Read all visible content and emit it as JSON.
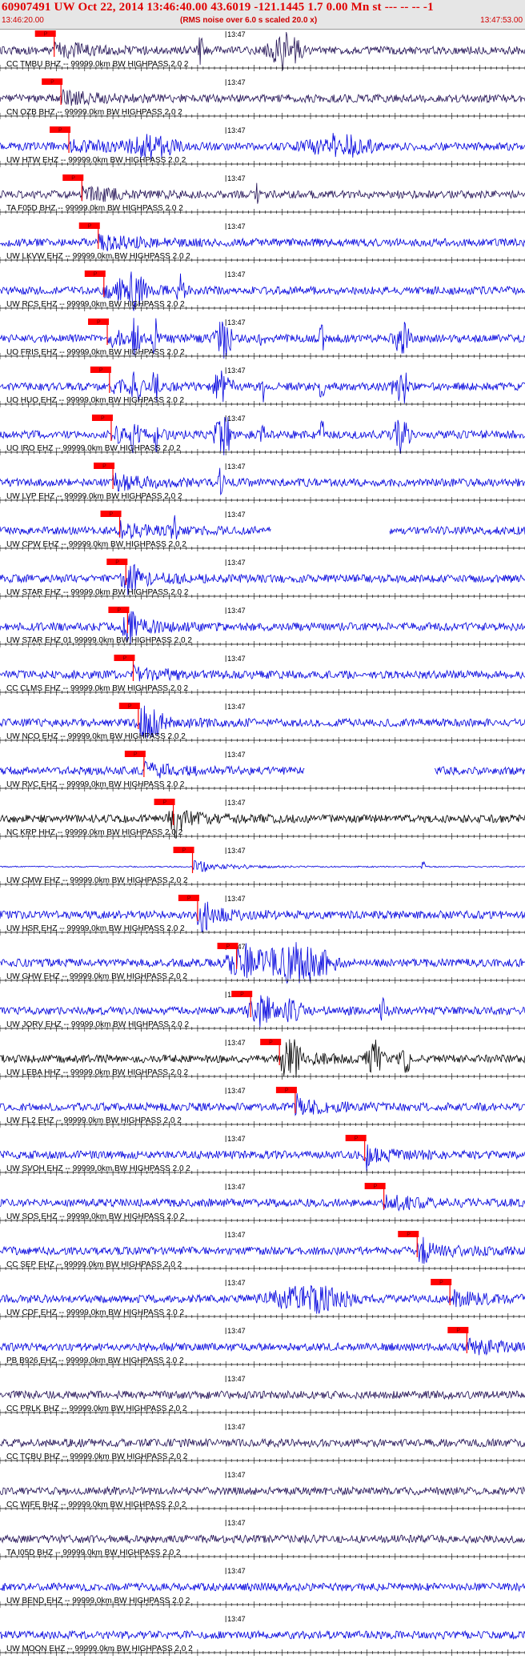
{
  "header": {
    "title": "60907491 UW Oct 22, 2014 13:46:40.00   43.6019 -121.1445  1.7 0.00 Mn st --- -- --   -1",
    "start_time": "13:46:20.00",
    "subtitle": "(RMS noise over 6.0 s scaled 20.0 x)",
    "end_time": "13:47:53.00"
  },
  "minute_mark_label": "13:47",
  "pick_label": "P",
  "colors": {
    "header_bg": "#e6e6e6",
    "header_text": "#e00000",
    "trace_blue": "#0000dd",
    "trace_dark": "#221155",
    "trace_black": "#000000",
    "pick": "#ff0000",
    "axis": "#000000"
  },
  "traces": [
    {
      "label": "CC TMBU BHZ -- 99999.0km BW  HIGHPASS  2.0  2",
      "color": "dark",
      "pick_s": 9.6,
      "events": [
        {
          "t": 13.5,
          "a": 0.9,
          "d": 0.6
        },
        {
          "t": 35.5,
          "a": 1.0,
          "d": 0.8
        },
        {
          "t": 50.5,
          "a": 1.2,
          "d": 4
        }
      ]
    },
    {
      "label": "CN OZB BHZ -- 99999.0km BW  HIGHPASS  2.0  2",
      "color": "dark",
      "pick_s": 10.8,
      "events": []
    },
    {
      "label": "UW HTW EHZ -- 99999.0km BW  HIGHPASS  2.0  2",
      "color": "blue",
      "pick_s": 12.2,
      "events": [
        {
          "t": 27,
          "a": 0.6,
          "d": 6
        },
        {
          "t": 60,
          "a": 0.7,
          "d": 8
        }
      ]
    },
    {
      "label": "TA F05D BHZ -- 99999.0km BW  HIGHPASS  2.0  2",
      "color": "dark",
      "pick_s": 14.5,
      "events": [
        {
          "t": 45.5,
          "a": 0.6,
          "d": 0.4
        }
      ]
    },
    {
      "label": "UW LKVW EHZ -- 99999.0km BW  HIGHPASS  2.0  2",
      "color": "blue",
      "pick_s": 17.4,
      "events": []
    },
    {
      "label": "UW RCS EHZ -- 99999.0km BW  HIGHPASS  2.0  2",
      "color": "blue",
      "pick_s": 18.4,
      "events": [
        {
          "t": 23.5,
          "a": 1.2,
          "d": 3
        },
        {
          "t": 32,
          "a": 0.9,
          "d": 1
        }
      ]
    },
    {
      "label": "UO FRIS EHZ -- 99999.0km BW  HIGHPASS  2.0  2",
      "color": "blue",
      "pick_s": 19.0,
      "events": [
        {
          "t": 24,
          "a": 1.4,
          "d": 1
        },
        {
          "t": 27.5,
          "a": 1.4,
          "d": 0.6
        },
        {
          "t": 39.5,
          "a": 1.6,
          "d": 2
        },
        {
          "t": 46.5,
          "a": 1.2,
          "d": 0.5
        },
        {
          "t": 57,
          "a": 1.2,
          "d": 0.5
        },
        {
          "t": 71,
          "a": 1.3,
          "d": 2
        }
      ]
    },
    {
      "label": "UO HUO EHZ -- 99999.0km BW  HIGHPASS  2.0  2",
      "color": "blue",
      "pick_s": 19.4,
      "events": [
        {
          "t": 24,
          "a": 1.4,
          "d": 1
        },
        {
          "t": 27.5,
          "a": 1.4,
          "d": 0.6
        },
        {
          "t": 39.5,
          "a": 1.6,
          "d": 2
        },
        {
          "t": 46.5,
          "a": 1.2,
          "d": 0.5
        },
        {
          "t": 57,
          "a": 1.2,
          "d": 0.5
        },
        {
          "t": 71,
          "a": 1.3,
          "d": 2
        }
      ]
    },
    {
      "label": "UO IRO EHZ -- 99999.0km BW  HIGHPASS  2.0  2",
      "color": "blue",
      "pick_s": 19.7,
      "events": [
        {
          "t": 24,
          "a": 1.4,
          "d": 1
        },
        {
          "t": 27.5,
          "a": 1.4,
          "d": 0.6
        },
        {
          "t": 39.5,
          "a": 1.6,
          "d": 2
        },
        {
          "t": 46.5,
          "a": 1.2,
          "d": 0.5
        },
        {
          "t": 57,
          "a": 1.2,
          "d": 0.5
        },
        {
          "t": 71,
          "a": 1.3,
          "d": 2
        }
      ]
    },
    {
      "label": "UW LVP EHZ -- 99999.0km BW  HIGHPASS  2.0  2",
      "color": "blue",
      "pick_s": 20.0,
      "events": [
        {
          "t": 39,
          "a": 0.7,
          "d": 1
        }
      ]
    },
    {
      "label": "UW CPW EHZ -- 99999.0km BW  HIGHPASS  2.0  2",
      "color": "blue",
      "pick_s": 21.2,
      "gap": [
        48,
        69
      ],
      "events": [
        {
          "t": 31,
          "a": 0.8,
          "d": 1
        }
      ]
    },
    {
      "label": "UW STAR EHZ -- 99999.0km BW  HIGHPASS  2.0  2",
      "color": "blue",
      "pick_s": 22.3,
      "events": [
        {
          "t": 23,
          "a": 0.9,
          "d": 2
        }
      ]
    },
    {
      "label": "UW STAR EHZ 01 99999.0km BW  HIGHPASS  2.0  2",
      "color": "blue",
      "pick_s": 22.6,
      "events": [
        {
          "t": 23,
          "a": 0.9,
          "d": 2
        }
      ]
    },
    {
      "label": "CC CLMS EHZ -- 99999.0km BW  HIGHPASS  2.0  2",
      "color": "blue",
      "pick_s": 23.6,
      "events": []
    },
    {
      "label": "UW NCO EHZ -- 99999.0km BW  HIGHPASS  2.0  2",
      "color": "blue",
      "pick_s": 24.5,
      "events": [
        {
          "t": 26.5,
          "a": 0.9,
          "d": 3
        }
      ]
    },
    {
      "label": "UW RVC EHZ -- 99999.0km BW  HIGHPASS  2.0  2",
      "color": "blue",
      "pick_s": 25.5,
      "gap": [
        54,
        77
      ],
      "events": []
    },
    {
      "label": "NC KRP HHZ -- 99999.0km BW  HIGHPASS  2.0  2",
      "color": "black",
      "pick_s": 30.7,
      "events": [
        {
          "t": 31,
          "a": 0.7,
          "d": 2
        }
      ]
    },
    {
      "label": "UW CMW EHZ -- 99999.0km BW  HIGHPASS  2.0  2",
      "color": "blue",
      "pick_s": 34.1,
      "quiet": true,
      "events": [
        {
          "t": 75,
          "a": 0.5,
          "d": 0.4
        }
      ]
    },
    {
      "label": "UW HSR EHZ -- 99999.0km BW  HIGHPASS  2.0  2",
      "color": "blue",
      "pick_s": 35.0,
      "events": [
        {
          "t": 36,
          "a": 0.6,
          "d": 2
        }
      ]
    },
    {
      "label": "UW GHW EHZ -- 99999.0km BW  HIGHPASS  2.0  2",
      "color": "blue",
      "pick_s": 41.9,
      "events": [
        {
          "t": 43,
          "a": 1.0,
          "d": 4
        },
        {
          "t": 53,
          "a": 1.3,
          "d": 8
        }
      ]
    },
    {
      "label": "UW JORV EHZ -- 99999.0km BW  HIGHPASS  2.0  2",
      "color": "blue",
      "pick_s": 44.4,
      "events": [
        {
          "t": 46,
          "a": 0.8,
          "d": 3
        },
        {
          "t": 52,
          "a": 0.7,
          "d": 2
        },
        {
          "t": 68,
          "a": 0.7,
          "d": 1
        }
      ]
    },
    {
      "label": "UW LEBA HHZ -- 99999.0km BW  HIGHPASS  2.0  2",
      "color": "black",
      "pick_s": 49.5,
      "events": [
        {
          "t": 51.5,
          "a": 1.5,
          "d": 2
        },
        {
          "t": 66.5,
          "a": 1.1,
          "d": 2
        },
        {
          "t": 72,
          "a": 0.7,
          "d": 2
        }
      ]
    },
    {
      "label": "UW FL2 EHZ -- 99999.0km BW  HIGHPASS  2.0  2",
      "color": "blue",
      "pick_s": 52.3,
      "events": [
        {
          "t": 53,
          "a": 0.5,
          "d": 1
        }
      ]
    },
    {
      "label": "UW SVOH EHZ -- 99999.0km BW  HIGHPASS  2.0  2",
      "color": "blue",
      "pick_s": 64.6,
      "events": [
        {
          "t": 65,
          "a": 0.6,
          "d": 0.8
        }
      ]
    },
    {
      "label": "UW SOS EHZ -- 99999.0km BW  HIGHPASS  2.0  2",
      "color": "blue",
      "pick_s": 68.0,
      "events": []
    },
    {
      "label": "CC SEP EHZ -- 99999.0km BW  HIGHPASS  2.0  2",
      "color": "blue",
      "pick_s": 73.9,
      "events": [
        {
          "t": 75,
          "a": 0.6,
          "d": 1
        }
      ]
    },
    {
      "label": "UW CDF EHZ -- 99999.0km BW  HIGHPASS  2.0  2",
      "color": "blue",
      "pick_s": 79.7,
      "events": [
        {
          "t": 55,
          "a": 0.8,
          "d": 10
        }
      ]
    },
    {
      "label": "PB B926 EHZ -- 99999.0km BW  HIGHPASS  2.0  2",
      "color": "blue",
      "pick_s": 82.7,
      "events": []
    },
    {
      "label": "CC PRLK BHZ -- 99999.0km BW  HIGHPASS  2.0  2",
      "color": "dark",
      "pick_s": null,
      "events": []
    },
    {
      "label": "CC TCBU BHZ -- 99999.0km BW  HIGHPASS  2.0  2",
      "color": "dark",
      "pick_s": null,
      "events": []
    },
    {
      "label": "CC WIFE BHZ -- 99999.0km BW  HIGHPASS  2.0  2",
      "color": "dark",
      "pick_s": null,
      "events": []
    },
    {
      "label": "TA I05D BHZ -- 99999.0km BW  HIGHPASS  2.0  2",
      "color": "dark",
      "pick_s": null,
      "events": []
    },
    {
      "label": "UW BEND EHZ -- 99999.0km BW  HIGHPASS  2.0  2",
      "color": "blue",
      "pick_s": null,
      "events": []
    },
    {
      "label": "UW MOON EHZ -- 99999.0km BW  HIGHPASS  2.0  2",
      "color": "blue",
      "pick_s": null,
      "events": []
    }
  ],
  "time_range_s": [
    0,
    93
  ],
  "minute_mark_s": 40
}
